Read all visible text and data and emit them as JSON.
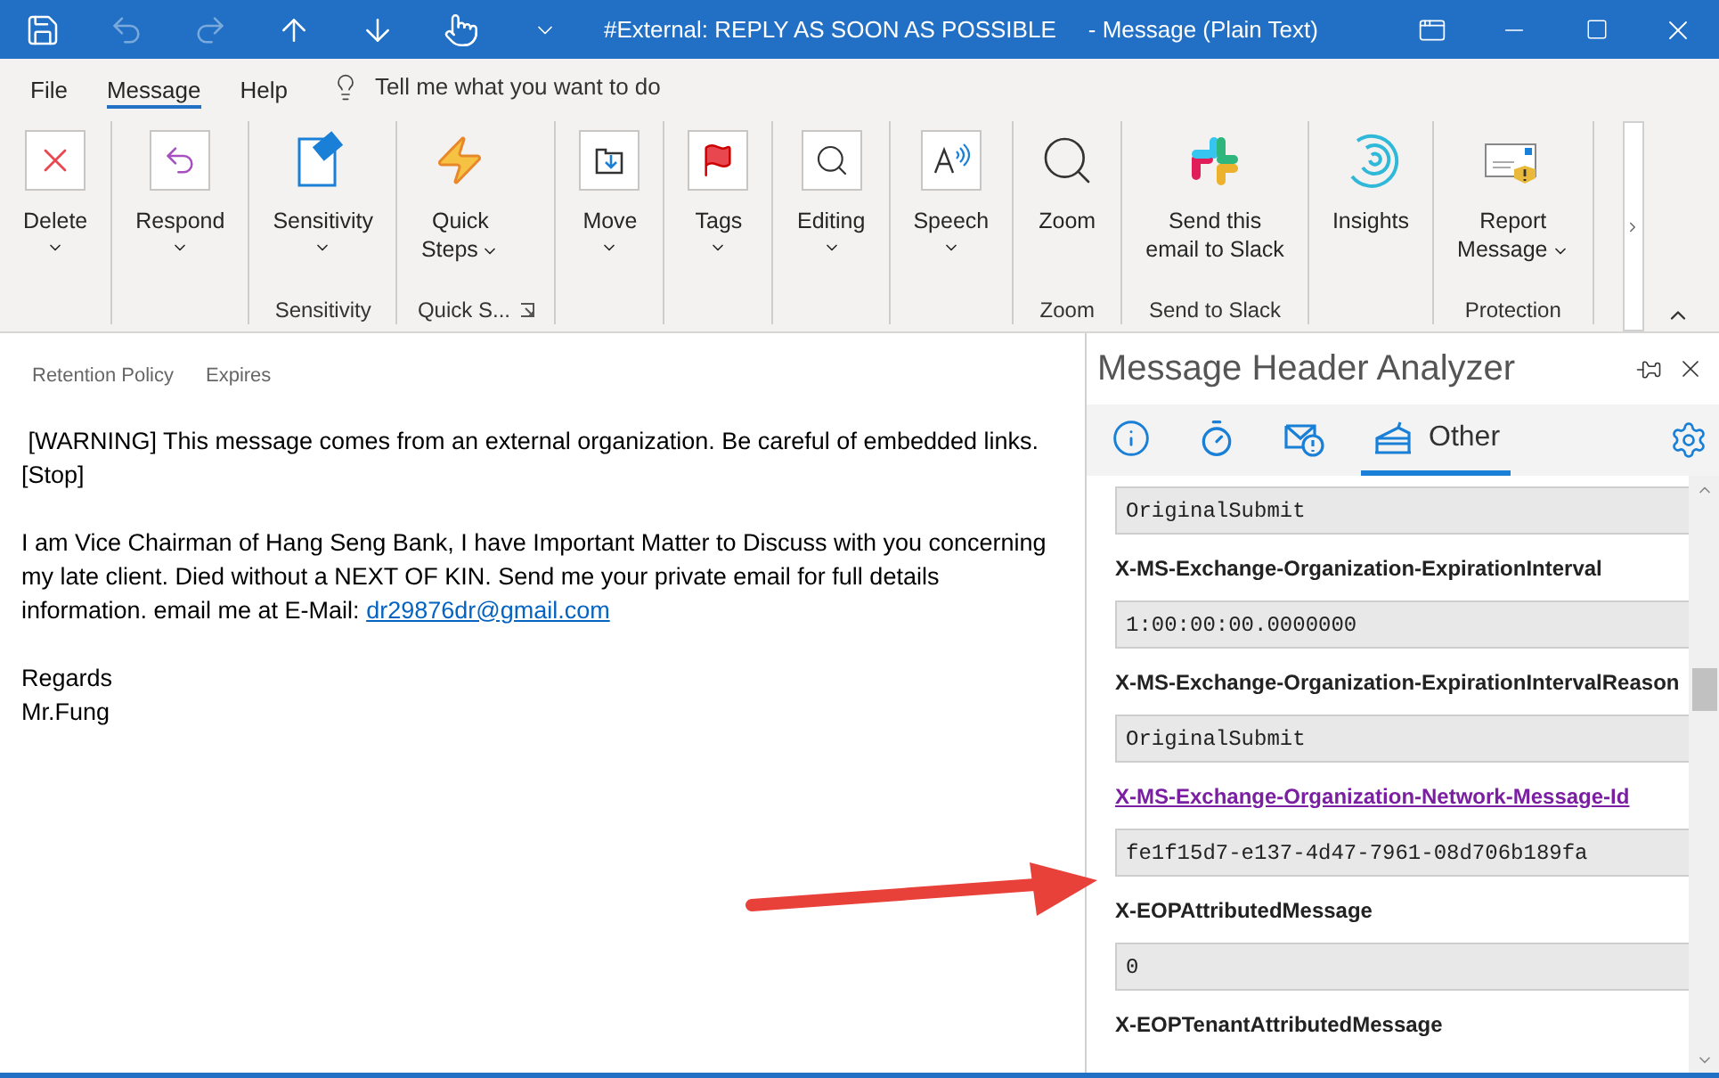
{
  "title_bar": {
    "quick_access": [
      {
        "kind": "save",
        "disabled": false
      },
      {
        "kind": "undo",
        "disabled": true
      },
      {
        "kind": "redo",
        "disabled": true
      },
      {
        "kind": "up",
        "disabled": false
      },
      {
        "kind": "down",
        "disabled": false
      },
      {
        "kind": "touch",
        "disabled": false
      },
      {
        "kind": "customize",
        "disabled": false
      }
    ],
    "title": "#External: REPLY AS SOON AS POSSIBLE",
    "subtitle": "-  Message (Plain Text)"
  },
  "menu": {
    "tabs": [
      {
        "label": "File",
        "selected": false
      },
      {
        "label": "Message",
        "selected": true
      },
      {
        "label": "Help",
        "selected": false
      }
    ],
    "search": {
      "placeholder": "Tell me what you want to do"
    }
  },
  "ribbon": {
    "groups": [
      {
        "buttons": [
          {
            "kind": "delete",
            "label": [
              "Delete"
            ],
            "dropdown": true
          }
        ]
      },
      {
        "buttons": [
          {
            "kind": "respond",
            "label": [
              "Respond"
            ],
            "dropdown": true
          }
        ]
      },
      {
        "label": "Sensitivity",
        "buttons": [
          {
            "kind": "sensitivity",
            "label": [
              "Sensitivity"
            ],
            "dropdown": true
          }
        ]
      },
      {
        "label": "Quick S...",
        "launcher": true,
        "buttons": [
          {
            "kind": "quicksteps",
            "label": [
              "Quick",
              "Steps"
            ],
            "dropdown": true
          }
        ]
      },
      {
        "buttons": [
          {
            "kind": "move",
            "label": [
              "Move"
            ],
            "dropdown": true
          }
        ]
      },
      {
        "buttons": [
          {
            "kind": "tags",
            "label": [
              "Tags"
            ],
            "dropdown": true
          }
        ]
      },
      {
        "buttons": [
          {
            "kind": "editing",
            "label": [
              "Editing"
            ],
            "dropdown": true
          }
        ]
      },
      {
        "buttons": [
          {
            "kind": "speech",
            "label": [
              "Speech"
            ],
            "dropdown": true
          }
        ]
      },
      {
        "label": "Zoom",
        "buttons": [
          {
            "kind": "zoom",
            "label": [
              "Zoom"
            ],
            "dropdown": false
          }
        ]
      },
      {
        "label": "Send to Slack",
        "buttons": [
          {
            "kind": "slack",
            "label": [
              "Send this",
              "email to Slack"
            ],
            "dropdown": false
          }
        ]
      },
      {
        "buttons": [
          {
            "kind": "insights",
            "label": [
              "Insights"
            ],
            "dropdown": false
          }
        ]
      },
      {
        "label": "Protection",
        "buttons": [
          {
            "kind": "report",
            "label": [
              "Report",
              "Message"
            ],
            "dropdown": true
          }
        ]
      }
    ]
  },
  "email": {
    "header_fields": [
      "Retention Policy",
      "Expires"
    ],
    "paragraphs": [
      {
        "lines": [
          " [WARNING] This message comes from an external organization. Be careful of embedded links.",
          "[Stop]"
        ]
      },
      {
        "lines": [
          "I am Vice Chairman of Hang Seng Bank, I have Important Matter to Discuss with you concerning",
          "my late client. Died without a NEXT OF KIN. Send me your private email for full details",
          "information. email me at E-Mail: "
        ],
        "link": "dr29876dr@gmail.com"
      },
      {
        "lines": [
          "Regards",
          "Mr.Fung"
        ]
      }
    ]
  },
  "header_analyzer": {
    "title": "Message Header Analyzer",
    "tabs": [
      {
        "kind": "summary",
        "selected": false
      },
      {
        "kind": "timing",
        "selected": false
      },
      {
        "kind": "antispam",
        "selected": false
      },
      {
        "kind": "other",
        "label": "Other",
        "selected": true
      }
    ],
    "rows": [
      {
        "kind": "value",
        "text": "OriginalSubmit"
      },
      {
        "kind": "name",
        "text": "X-MS-Exchange-Organization-ExpirationInterval"
      },
      {
        "kind": "value",
        "text": "1:00:00:00.0000000"
      },
      {
        "kind": "name",
        "text": "X-MS-Exchange-Organization-ExpirationIntervalReason"
      },
      {
        "kind": "value",
        "text": "OriginalSubmit"
      },
      {
        "kind": "link",
        "text": "X-MS-Exchange-Organization-Network-Message-Id"
      },
      {
        "kind": "value",
        "text": "fe1f15d7-e137-4d47-7961-08d706b189fa"
      },
      {
        "kind": "name",
        "text": "X-EOPAttributedMessage"
      },
      {
        "kind": "value",
        "text": "0"
      },
      {
        "kind": "name",
        "text": "X-EOPTenantAttributedMessage"
      }
    ]
  }
}
